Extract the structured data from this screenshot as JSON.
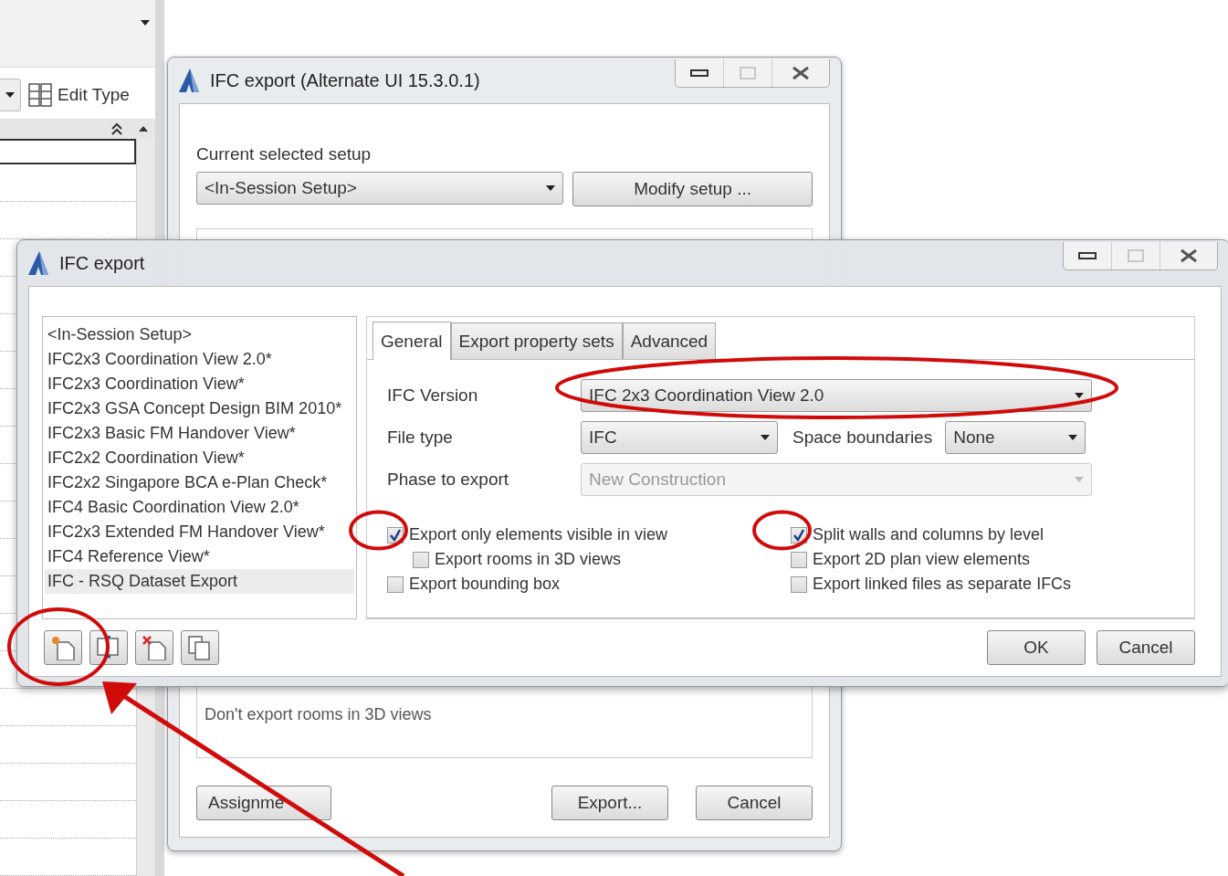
{
  "properties_panel": {
    "edit_type_button": "Edit Type"
  },
  "setup_window": {
    "title": "IFC export (Alternate UI 15.3.0.1)",
    "current_setup_label": "Current selected setup",
    "current_setup": "<In-Session Setup>",
    "modify_button": "Modify setup ...",
    "description": "Don't export rooms in 3D views",
    "buttons": [
      {
        "label": "Assignme",
        "kind": "left"
      },
      {
        "label": "Export...",
        "kind": "right"
      },
      {
        "label": "Cancel",
        "kind": "right"
      }
    ]
  },
  "export_window": {
    "title": "IFC export",
    "setups": [
      {
        "label": "<In-Session Setup>",
        "selected": false
      },
      {
        "label": "IFC2x3 Coordination View 2.0*",
        "selected": false
      },
      {
        "label": "IFC2x3 Coordination View*",
        "selected": false
      },
      {
        "label": "IFC2x3 GSA Concept Design BIM 2010*",
        "selected": false
      },
      {
        "label": "IFC2x3 Basic FM Handover View*",
        "selected": false
      },
      {
        "label": "IFC2x2 Coordination View*",
        "selected": false
      },
      {
        "label": "IFC2x2 Singapore BCA e-Plan Check*",
        "selected": false
      },
      {
        "label": "IFC4 Basic Coordination View 2.0*",
        "selected": false
      },
      {
        "label": "IFC2x3 Extended FM Handover View*",
        "selected": false
      },
      {
        "label": "IFC4 Reference View*",
        "selected": false
      },
      {
        "label": "IFC - RSQ Dataset Export",
        "selected": true
      }
    ],
    "setup_tools": [
      {
        "kind": "new",
        "highlighted": true,
        "pointer": true
      },
      {
        "kind": "rename",
        "highlighted": false,
        "pointer": false
      },
      {
        "kind": "delete",
        "highlighted": false,
        "pointer": false
      },
      {
        "kind": "copy",
        "highlighted": false,
        "pointer": false
      }
    ],
    "tabs": [
      {
        "label": "General",
        "selected": true
      },
      {
        "label": "Export property sets",
        "selected": false
      },
      {
        "label": "Advanced",
        "selected": false
      }
    ],
    "fields": [
      {
        "label": "IFC Version",
        "value": "IFC 2x3 Coordination View 2.0",
        "disabled": false,
        "highlighted": true
      },
      {
        "label": "File type",
        "value": "IFC",
        "disabled": false,
        "highlighted": false,
        "extra": {
          "label": "Space boundaries",
          "value": "None"
        }
      },
      {
        "label": "Phase to export",
        "value": "New Construction",
        "disabled": true,
        "highlighted": false
      }
    ],
    "option_columns": [
      {
        "options": [
          {
            "label": "Export only elements visible in view",
            "checked": true,
            "highlighted": true,
            "children": [
              {
                "label": "Export rooms in 3D views",
                "checked": false,
                "highlighted": false
              }
            ]
          },
          {
            "label": "Export bounding box",
            "checked": false,
            "highlighted": false
          }
        ]
      },
      {
        "options": [
          {
            "label": "Split walls and columns by level",
            "checked": true,
            "highlighted": true
          },
          {
            "label": "Export 2D plan view elements",
            "checked": false,
            "highlighted": false
          },
          {
            "label": "Export linked files as separate IFCs",
            "checked": false,
            "highlighted": false
          }
        ]
      }
    ],
    "buttons": [
      "OK",
      "Cancel"
    ]
  }
}
